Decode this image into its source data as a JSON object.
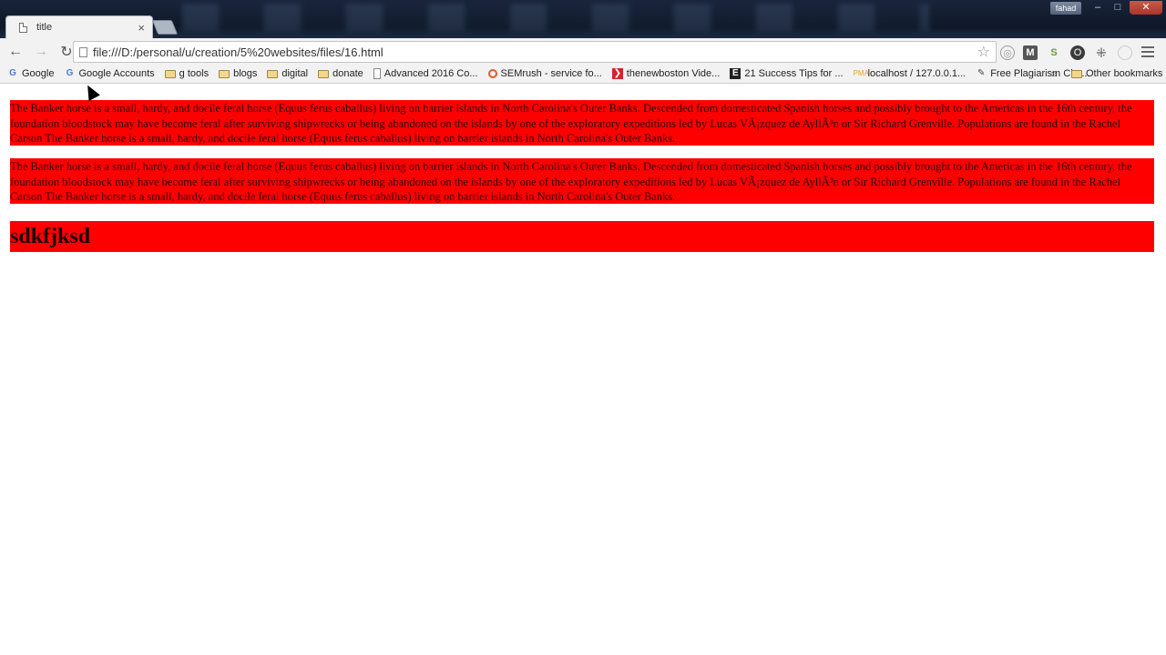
{
  "window": {
    "user_badge": "fahad",
    "minimize_glyph": "–",
    "maximize_glyph": "□",
    "close_glyph": "✕"
  },
  "tab": {
    "title": "title",
    "close_glyph": "×"
  },
  "toolbar": {
    "back_glyph": "←",
    "forward_glyph": "→",
    "reload_glyph": "↻",
    "url": "file:///D:/personal/u/creation/5%20websites/files/16.html",
    "star_glyph": "☆",
    "extensions": [
      {
        "name": "globe-icon",
        "glyph": "◎"
      },
      {
        "name": "m-extension-icon",
        "glyph": "M"
      },
      {
        "name": "s-extension-icon",
        "glyph": "S"
      },
      {
        "name": "o-extension-icon",
        "glyph": "O"
      },
      {
        "name": "grid-extension-icon",
        "glyph": "⁜"
      },
      {
        "name": "circle-extension-icon",
        "glyph": ""
      }
    ]
  },
  "bookmarks": {
    "items": [
      {
        "label": "Google",
        "icon": "google-icon",
        "glyph": "G"
      },
      {
        "label": "Google Accounts",
        "icon": "google-icon",
        "glyph": "G"
      },
      {
        "label": "g tools",
        "icon": "folder-icon",
        "glyph": ""
      },
      {
        "label": "blogs",
        "icon": "folder-icon",
        "glyph": ""
      },
      {
        "label": "digital",
        "icon": "folder-icon",
        "glyph": ""
      },
      {
        "label": "donate",
        "icon": "folder-icon",
        "glyph": ""
      },
      {
        "label": "Advanced 2016 Co...",
        "icon": "document-icon",
        "glyph": ""
      },
      {
        "label": "SEMrush - service fo...",
        "icon": "semrush-icon",
        "glyph": ""
      },
      {
        "label": "thenewboston Vide...",
        "icon": "thenewboston-icon",
        "glyph": "❯"
      },
      {
        "label": "21 Success Tips for ...",
        "icon": "e-icon",
        "glyph": "E"
      },
      {
        "label": "localhost / 127.0.0.1...",
        "icon": "phpmyadmin-icon",
        "glyph": "PMA"
      },
      {
        "label": "Free Plagiarism Che...",
        "icon": "pen-icon",
        "glyph": "✎"
      }
    ],
    "more_glyph": "»",
    "other_label": "Other bookmarks"
  },
  "content": {
    "paragraph1": "The Banker horse is a small, hardy, and docile feral horse (Equus ferus caballus) living on barrier islands in North Carolina's Outer Banks. Descended from domesticated Spanish horses and possibly brought to the Americas in the 16th century, the foundation bloodstock may have become feral after surviving shipwrecks or being abandoned on the islands by one of the exploratory expeditions led by Lucas VÃ¡zquez de AyllÃ³n or Sir Richard Grenville. Populations are found in the Rachel Carson The Banker horse is a small, hardy, and docile feral horse (Equus ferus caballus) living on barrier islands in North Carolina's Outer Banks.",
    "paragraph2": "The Banker horse is a small, hardy, and docile feral horse (Equus ferus caballus) living on barrier islands in North Carolina's Outer Banks. Descended from domesticated Spanish horses and possibly brought to the Americas in the 16th century, the foundation bloodstock may have become feral after surviving shipwrecks or being abandoned on the islands by one of the exploratory expeditions led by Lucas VÃ¡zquez de AyllÃ³n or Sir Richard Grenville. Populations are found in the Rachel Carson The Banker horse is a small, hardy, and docile feral horse (Equus ferus caballus) living on barrier islands in North Carolina's Outer Banks.",
    "heading": "sdkfjksd"
  },
  "colors": {
    "content_background": "#ff0000",
    "chrome_background": "#f2f2f2"
  }
}
